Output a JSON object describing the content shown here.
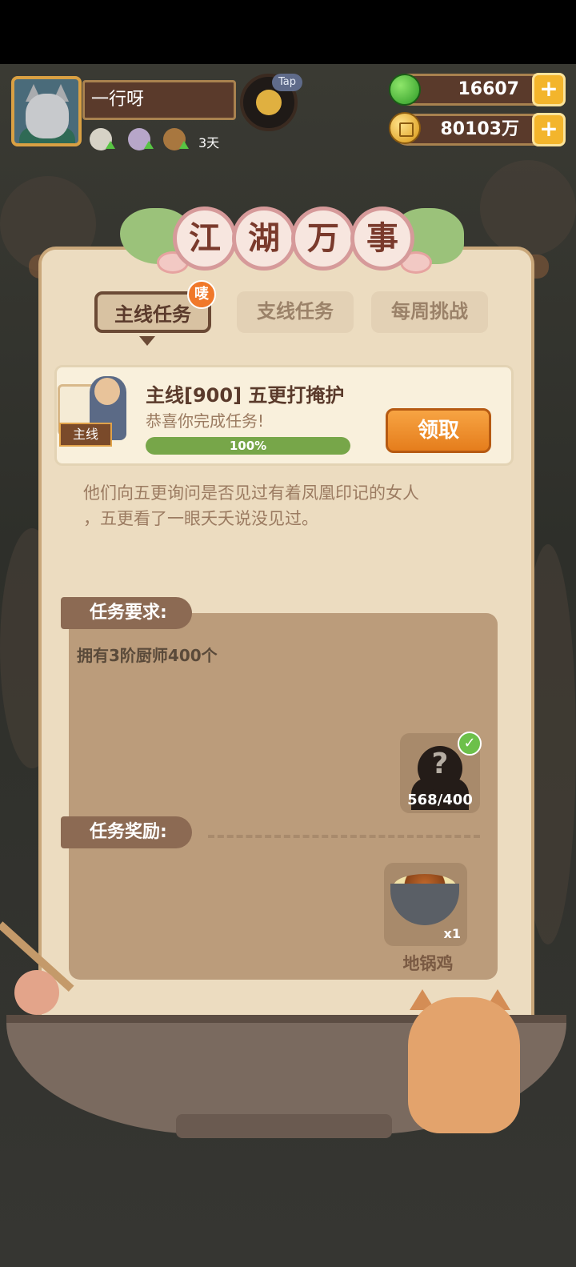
{
  "header": {
    "player_name": "一行呀",
    "tap_label": "Tap",
    "days": "3天",
    "green_currency": "16607",
    "gold_currency": "80103万"
  },
  "board": {
    "title_chars": [
      "江",
      "湖",
      "万",
      "事"
    ],
    "tabs": [
      {
        "label": "主线任务",
        "active": true
      },
      {
        "label": "支线任务",
        "active": false
      },
      {
        "label": "每周挑战",
        "active": false
      }
    ],
    "badge": "唛"
  },
  "task": {
    "tag": "主线",
    "title": "主线[900] 五更打掩护",
    "subtitle": "恭喜你完成任务!",
    "progress_percent": 100,
    "progress_text": "100%",
    "claim_label": "领取",
    "description_line1": "他们向五更询问是否见过有着凤凰印记的女人",
    "description_line2": "，五更看了一眼夭夭说没见过。"
  },
  "requirement": {
    "label": "任务要求:",
    "text": "拥有3阶厨师400个",
    "item_count": "568/400"
  },
  "reward": {
    "label": "任务奖励:",
    "item_name": "地锅鸡",
    "item_qty": "x1"
  },
  "colors": {
    "accent_orange": "#e57d1c",
    "progress_green": "#77a649",
    "label_brown": "#8c6a53"
  }
}
